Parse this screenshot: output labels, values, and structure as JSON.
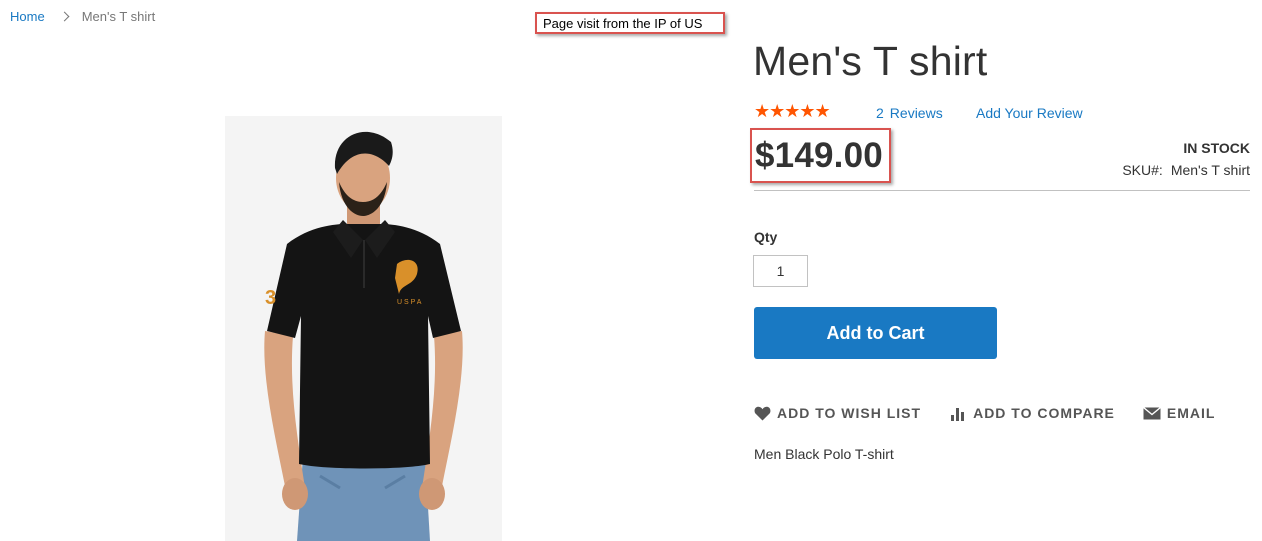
{
  "breadcrumb": {
    "home": "Home",
    "current": "Men's T shirt"
  },
  "annotation": {
    "text": "Page visit from the IP of US"
  },
  "product": {
    "title": "Men's T shirt",
    "rating_stars": "★★★★★",
    "rating_value": 5,
    "rating_max": 5,
    "reviews_count": "2",
    "reviews_label": "Reviews",
    "add_review": "Add Your Review",
    "price": "$149.00",
    "stock": "IN STOCK",
    "sku_label": "SKU#:",
    "sku_value": "Men's T shirt",
    "qty_label": "Qty",
    "qty_value": "1",
    "add_to_cart": "Add to Cart",
    "description": "Men Black Polo T-shirt"
  },
  "actions": {
    "wishlist": "Add to Wish List",
    "compare": "Add to Compare",
    "email": "Email"
  },
  "icons": {
    "wishlist": "heart-icon",
    "compare": "bar-chart-icon",
    "email": "envelope-icon",
    "breadcrumb_sep": "chevron-right-icon"
  },
  "colors": {
    "accent": "#1979c3",
    "stars": "#ff5501",
    "annotation_border": "#d9534f"
  }
}
